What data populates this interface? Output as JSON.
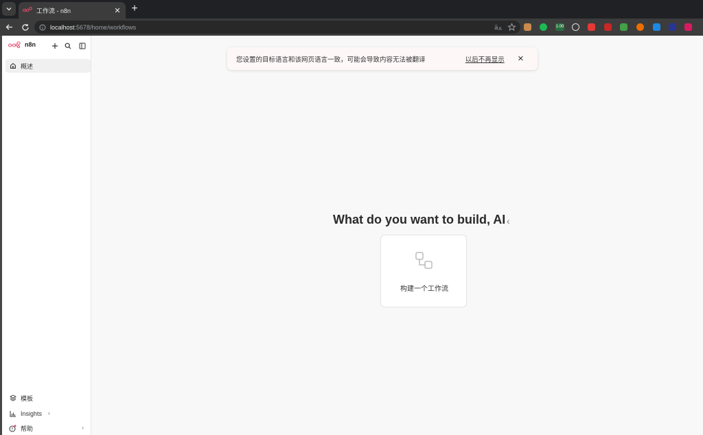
{
  "browser": {
    "tab_title": "工作流 - n8n",
    "url_host": "localhost",
    "url_path": ":5678/home/workflows",
    "extensions": [
      {
        "name": "ext-1-icon",
        "color": "#c98a4b"
      },
      {
        "name": "ext-2-icon",
        "color": "#1db954"
      },
      {
        "name": "ext-3-icon",
        "color": "#2b6e3f"
      },
      {
        "name": "ext-4-icon",
        "color": "#dddddd"
      },
      {
        "name": "ext-5-icon",
        "color": "#e53935"
      },
      {
        "name": "ext-6-icon",
        "color": "#c62828"
      },
      {
        "name": "ext-7-icon",
        "color": "#43a047"
      },
      {
        "name": "ext-8-icon",
        "color": "#ef6c00"
      },
      {
        "name": "ext-9-icon",
        "color": "#1e88e5"
      },
      {
        "name": "ext-10-icon",
        "color": "#283593"
      },
      {
        "name": "ext-11-icon",
        "color": "#d81b60"
      }
    ],
    "ext_badge": "1.00"
  },
  "app": {
    "logo_text": "n8n",
    "brand_color": "#ea4b71"
  },
  "sidebar": {
    "overview_label": "概述",
    "templates_label": "模板",
    "insights_label": "Insights",
    "help_label": "帮助"
  },
  "banner": {
    "message": "您设置的目标语言和该网页语言一致，可能会导致内容无法被翻译",
    "dismiss_link": "以后不再显示"
  },
  "hero": {
    "title": "What do you want to build, AI",
    "card_label": "构建一个工作流"
  }
}
